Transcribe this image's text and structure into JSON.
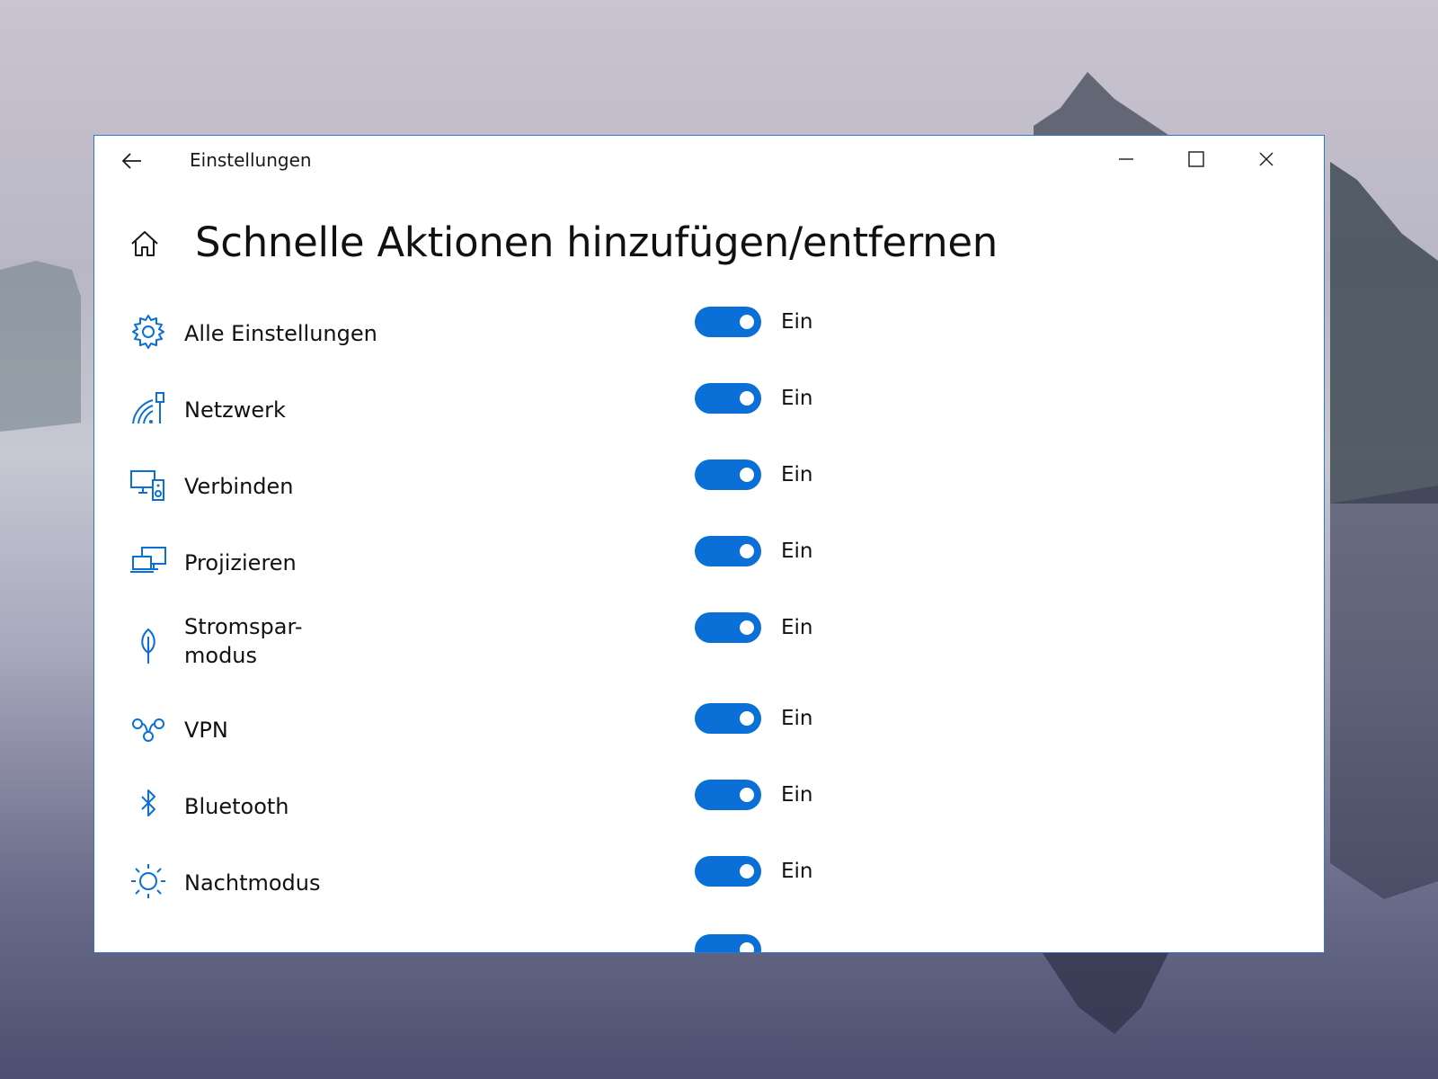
{
  "window": {
    "title": "Einstellungen"
  },
  "page": {
    "title": "Schnelle Aktionen hinzufügen/entfernen"
  },
  "colors": {
    "accent": "#0a6fd6",
    "window_border": "#2d7ad6",
    "text": "#111111"
  },
  "actions": [
    {
      "label": "Alle Einstellungen",
      "icon": "gear-icon",
      "state": "Ein",
      "on": true
    },
    {
      "label": "Netzwerk",
      "icon": "network-icon",
      "state": "Ein",
      "on": true
    },
    {
      "label": "Verbinden",
      "icon": "connect-icon",
      "state": "Ein",
      "on": true
    },
    {
      "label": "Projizieren",
      "icon": "project-icon",
      "state": "Ein",
      "on": true
    },
    {
      "label_line1": "Stromspar-",
      "label_line2": "modus",
      "icon": "battery-saver-icon",
      "state": "Ein",
      "on": true
    },
    {
      "label": "VPN",
      "icon": "vpn-icon",
      "state": "Ein",
      "on": true
    },
    {
      "label": "Bluetooth",
      "icon": "bluetooth-icon",
      "state": "Ein",
      "on": true
    },
    {
      "label": "Nachtmodus",
      "icon": "night-light-icon",
      "state": "Ein",
      "on": true
    }
  ]
}
